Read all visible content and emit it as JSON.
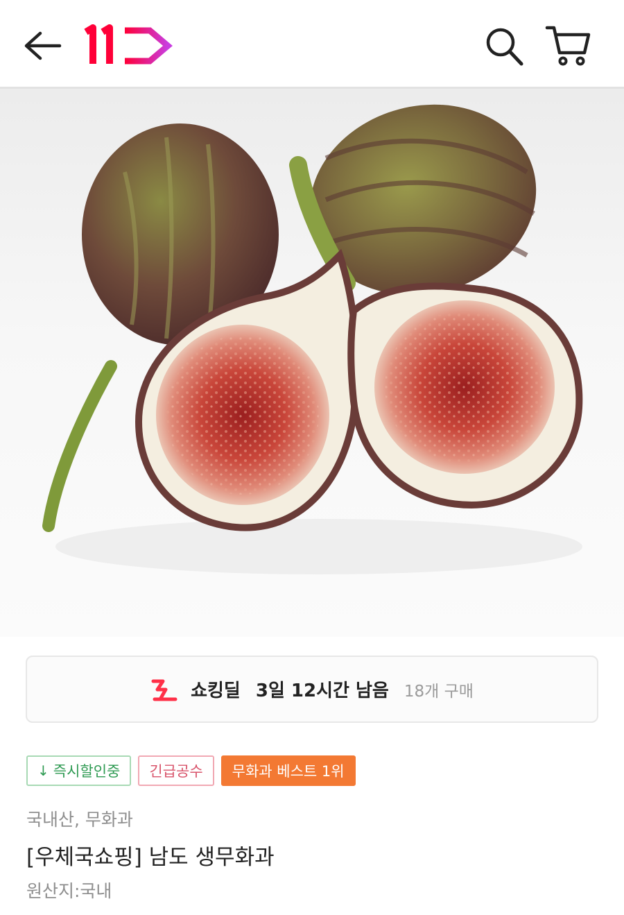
{
  "header": {
    "logo_text": "11",
    "brand_color": "#ff0038",
    "brand_accent": "#c93de0",
    "icons": [
      "back-arrow-icon",
      "search-icon",
      "cart-icon"
    ]
  },
  "hero": {
    "subject": "figs-image"
  },
  "deal": {
    "icon": "shocking-deal-icon",
    "name": "쇼킹딜",
    "time_left": "3일 12시간 남음",
    "purchase_count": "18개 구매"
  },
  "badges": [
    {
      "label": "즉시할인중",
      "icon": "down-arrow-icon",
      "color": "#2e9a52"
    },
    {
      "label": "긴급공수",
      "color": "#d8536a"
    },
    {
      "label": "무화과 베스트 1위",
      "color": "#f37933"
    }
  ],
  "product": {
    "category": "국내산, 무화과",
    "title": "[우체국쇼핑] 남도 생무화과",
    "origin": "원산지:국내"
  }
}
